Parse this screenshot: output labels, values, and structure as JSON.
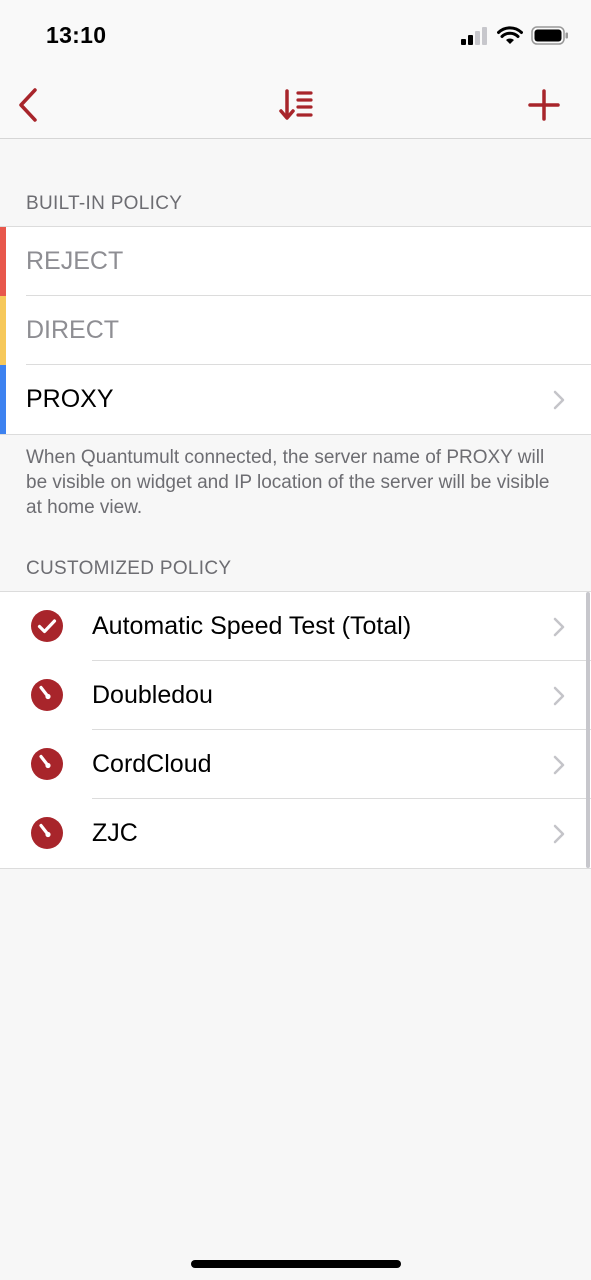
{
  "status_bar": {
    "time": "13:10"
  },
  "nav": {
    "back_icon": "chevron-left-icon",
    "sort_icon": "sort-list-icon",
    "add_icon": "plus-icon",
    "accent": "#a8252b"
  },
  "builtin": {
    "header": "BUILT-IN POLICY",
    "items": [
      {
        "label": "REJECT",
        "color": "#e8574c",
        "enabled": false
      },
      {
        "label": "DIRECT",
        "color": "#f6c85a",
        "enabled": false
      },
      {
        "label": "PROXY",
        "color": "#3d82f0",
        "enabled": true
      }
    ],
    "note": "When Quantumult connected, the server name of PROXY will be visible on widget and IP location of the server will be visible at home view."
  },
  "customized": {
    "header": "CUSTOMIZED POLICY",
    "items": [
      {
        "label": "Automatic Speed Test (Total)",
        "icon": "checkmark-circle-icon"
      },
      {
        "label": "Doubledou",
        "icon": "gauge-icon"
      },
      {
        "label": "CordCloud",
        "icon": "gauge-icon"
      },
      {
        "label": "ZJC",
        "icon": "gauge-icon"
      }
    ]
  }
}
